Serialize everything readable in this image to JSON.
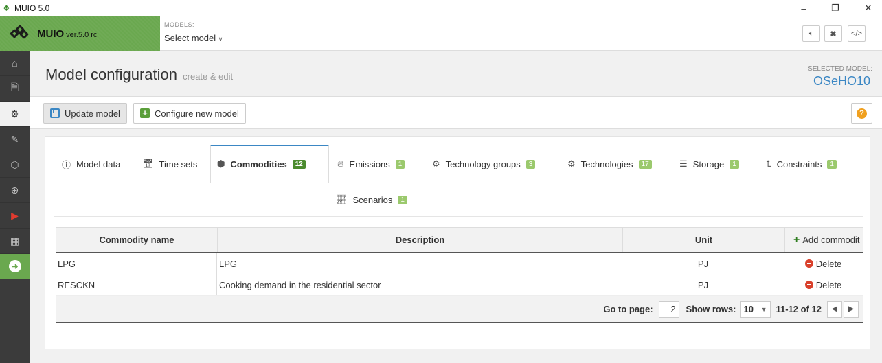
{
  "window": {
    "title": "MUIO 5.0"
  },
  "brand": {
    "name": "MUIO",
    "version": "ver.5.0 rc"
  },
  "models": {
    "label": "MODELS:",
    "select": "Select model"
  },
  "page": {
    "title": "Model configuration",
    "subtitle": "create & edit",
    "selected_label": "SELECTED MODEL:",
    "selected_value": "OSeHO10"
  },
  "toolbar": {
    "update": "Update model",
    "configure": "Configure new model"
  },
  "tabs": [
    {
      "label": "Model data"
    },
    {
      "label": "Time sets"
    },
    {
      "label": "Commodities",
      "badge": "12"
    },
    {
      "label": "Emissions",
      "badge": "1"
    },
    {
      "label": "Technology groups",
      "badge": "3"
    },
    {
      "label": "Technologies",
      "badge": "17"
    },
    {
      "label": "Storage",
      "badge": "1"
    },
    {
      "label": "Constraints",
      "badge": "1"
    },
    {
      "label": "Scenarios",
      "badge": "1"
    }
  ],
  "table": {
    "headers": {
      "name": "Commodity name",
      "description": "Description",
      "unit": "Unit",
      "add": "Add commodit"
    },
    "rows": [
      {
        "name": "LPG",
        "description": "LPG",
        "unit": "PJ",
        "action": "Delete"
      },
      {
        "name": "RESCKN",
        "description": "Cooking demand in the residential sector",
        "unit": "PJ",
        "action": "Delete"
      }
    ]
  },
  "pager": {
    "goto_label": "Go to page:",
    "page": "2",
    "rows_label": "Show rows:",
    "rows": "10",
    "range": "11-12 of 12"
  },
  "colors": {
    "brand_green": "#6aa84f",
    "accent_blue": "#3b87c4",
    "badge_green": "#9bc96d",
    "delete_red": "#d9402b"
  }
}
